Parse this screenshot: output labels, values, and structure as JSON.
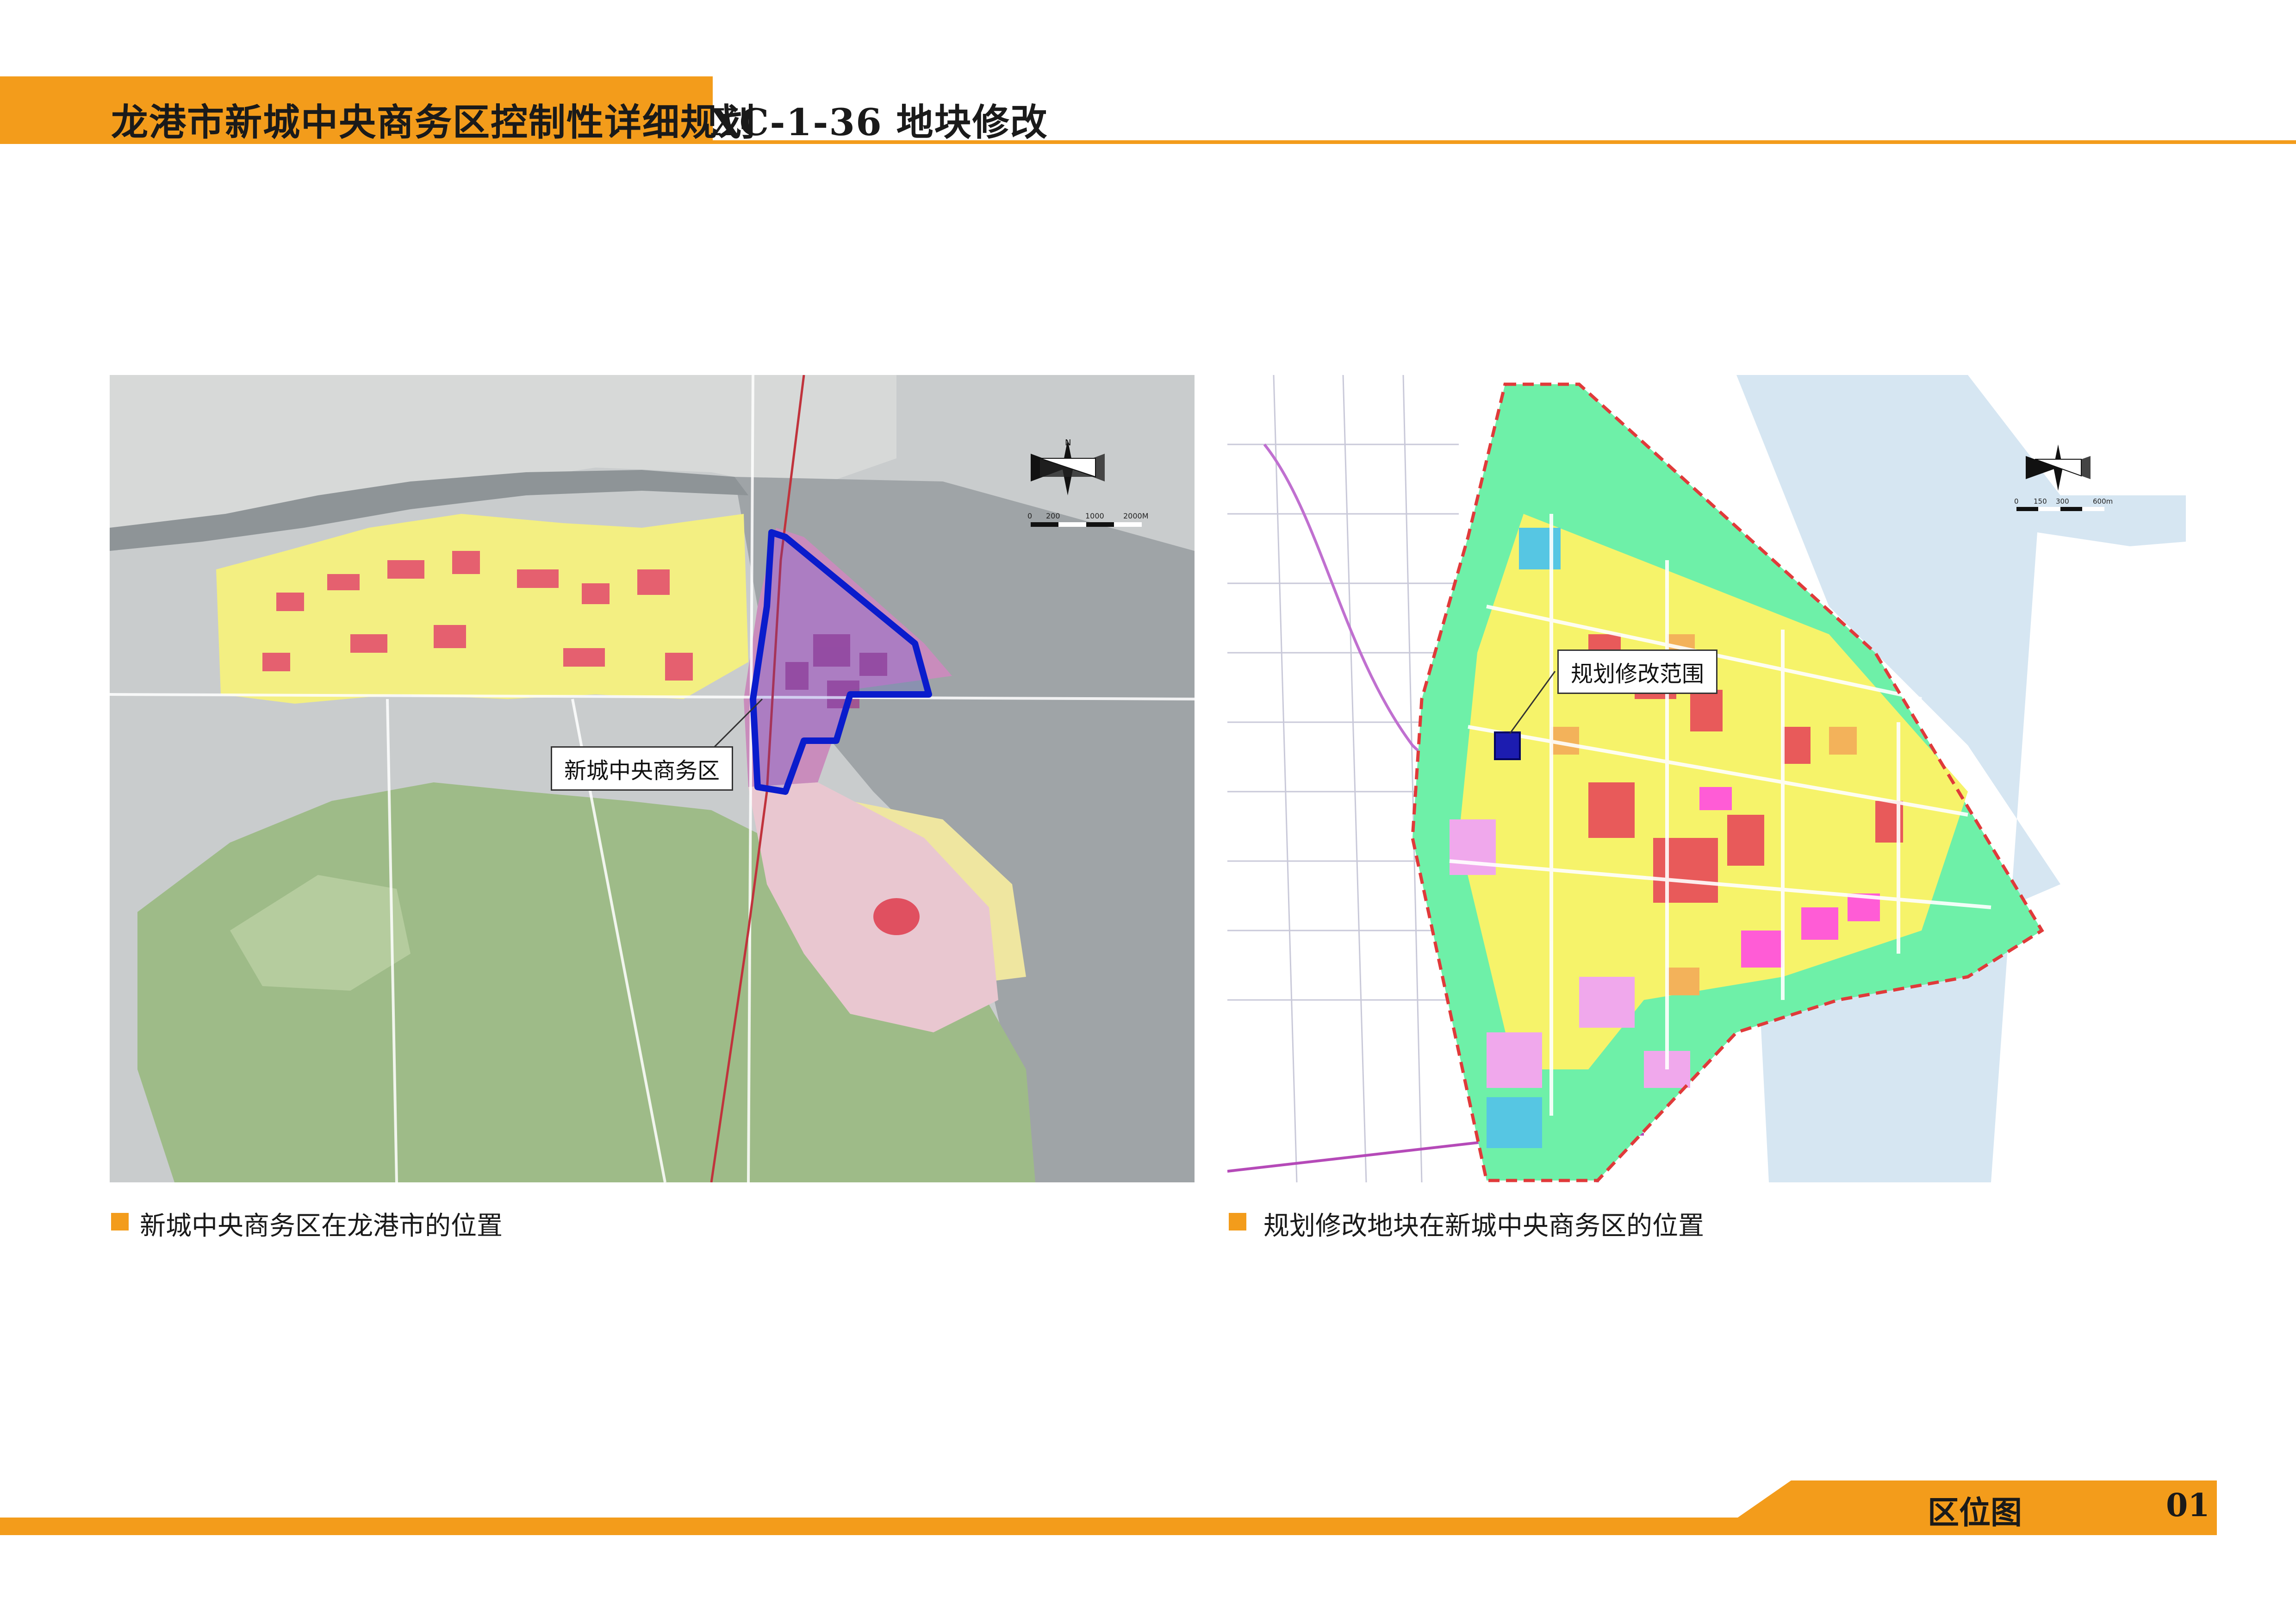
{
  "header": {
    "title": "龙港市新城中央商务区控制性详细规划",
    "subtitle": "XC-1-36 地块修改"
  },
  "left_map": {
    "callout": "新城中央商务区",
    "caption": "新城中央商务区在龙港市的位置",
    "scale_labels": [
      "0",
      "200",
      "1000",
      "2000M"
    ],
    "compass_label": "N",
    "colors": {
      "boundary": "#0a1ccc",
      "water": "#9ea3a6",
      "greenery": "#9cba86",
      "residential": "#f4f07a",
      "commercial": "#e55a6c"
    }
  },
  "right_map": {
    "callout": "规划修改范围",
    "caption": "规划修改地块在新城中央商务区的位置",
    "scale_labels": [
      "0",
      "150",
      "300",
      "600m"
    ],
    "colors": {
      "site": "#1c1cb0",
      "water": "#d6e6f2",
      "green_belt": "#6ef0a8",
      "boundary": "#e03a3a"
    }
  },
  "footer": {
    "label": "区位图",
    "page": "01",
    "accent": "#f39c1b"
  }
}
